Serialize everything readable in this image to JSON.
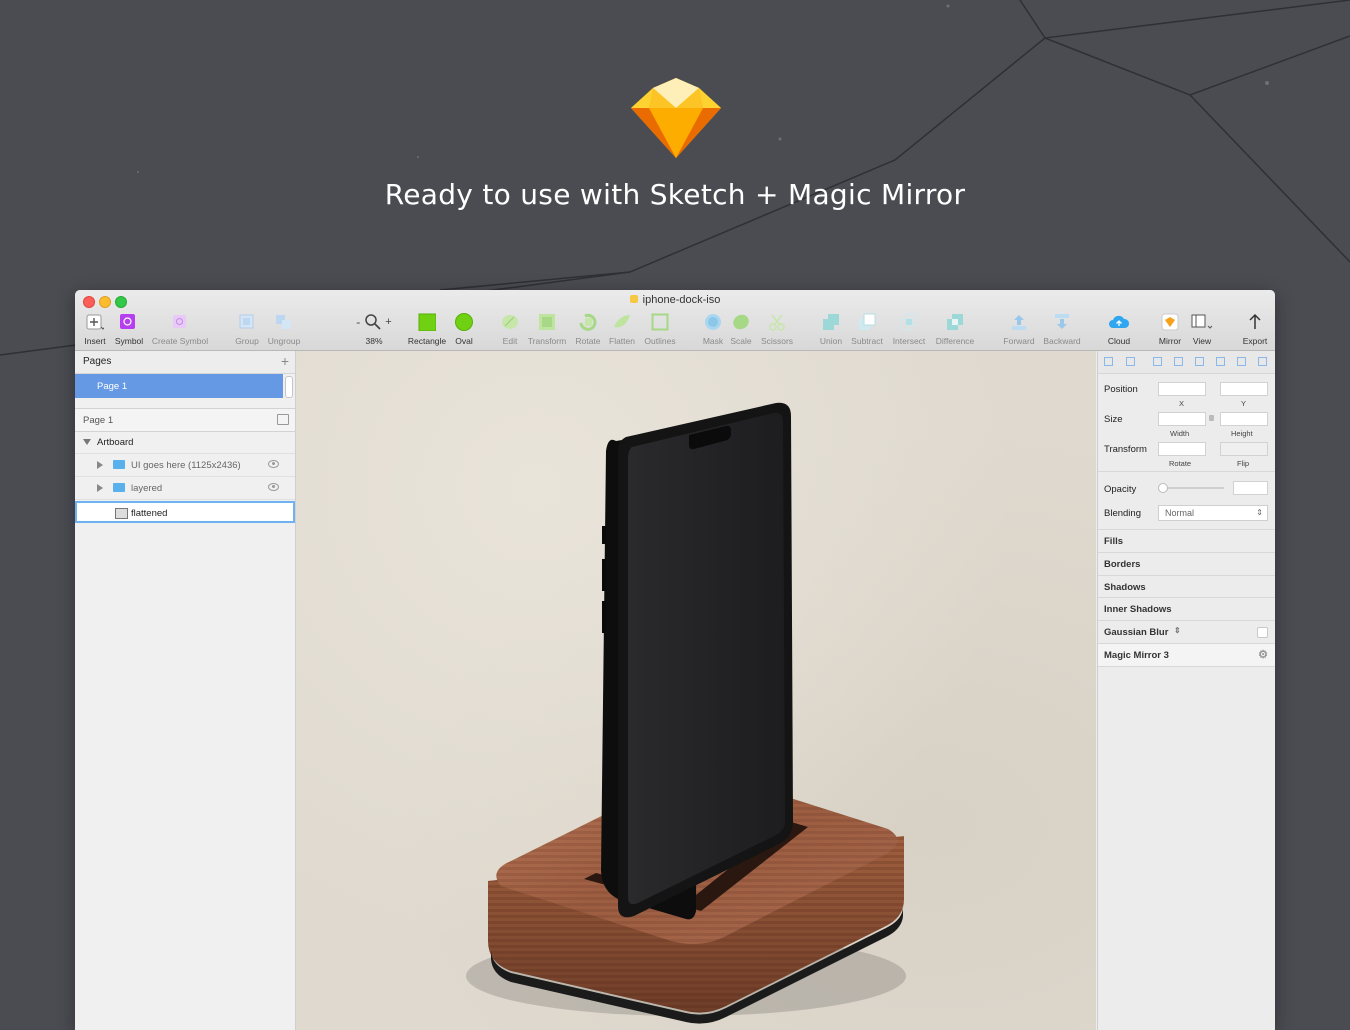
{
  "headline": "Ready to use with Sketch + Magic Mirror",
  "window": {
    "document_title": "iphone-dock-iso"
  },
  "toolbar": {
    "insert": "Insert",
    "symbol": "Symbol",
    "create_symbol": "Create Symbol",
    "group": "Group",
    "ungroup": "Ungroup",
    "zoom_minus": "-",
    "zoom_plus": "+",
    "zoom_value": "38%",
    "rectangle": "Rectangle",
    "oval": "Oval",
    "edit": "Edit",
    "transform": "Transform",
    "rotate": "Rotate",
    "flatten": "Flatten",
    "outlines": "Outlines",
    "mask": "Mask",
    "scale": "Scale",
    "scissors": "Scissors",
    "union": "Union",
    "subtract": "Subtract",
    "intersect": "Intersect",
    "difference": "Difference",
    "forward": "Forward",
    "backward": "Backward",
    "cloud": "Cloud",
    "mirror": "Mirror",
    "view": "View",
    "export": "Export"
  },
  "pages_panel": {
    "title": "Pages",
    "pages": [
      "Page 1"
    ],
    "current_page": "Page 1"
  },
  "layers": {
    "artboard": "Artboard",
    "items": [
      {
        "name": "UI goes here (1125x2436)",
        "type": "folder"
      },
      {
        "name": "layered",
        "type": "folder"
      },
      {
        "name": "flattened",
        "type": "image",
        "selected": true
      }
    ]
  },
  "inspector": {
    "position": "Position",
    "x": "X",
    "y": "Y",
    "size": "Size",
    "width": "Width",
    "height": "Height",
    "transform": "Transform",
    "rotate": "Rotate",
    "flip": "Flip",
    "opacity": "Opacity",
    "blending": "Blending",
    "blending_value": "Normal",
    "sections": [
      "Fills",
      "Borders",
      "Shadows",
      "Inner Shadows",
      "Gaussian Blur",
      "Magic Mirror 3"
    ]
  },
  "colors": {
    "background": "#4a4c52",
    "selection": "#6699e3",
    "sketch_orange": "#f7a01b",
    "folder_blue": "#5ab0ec"
  }
}
